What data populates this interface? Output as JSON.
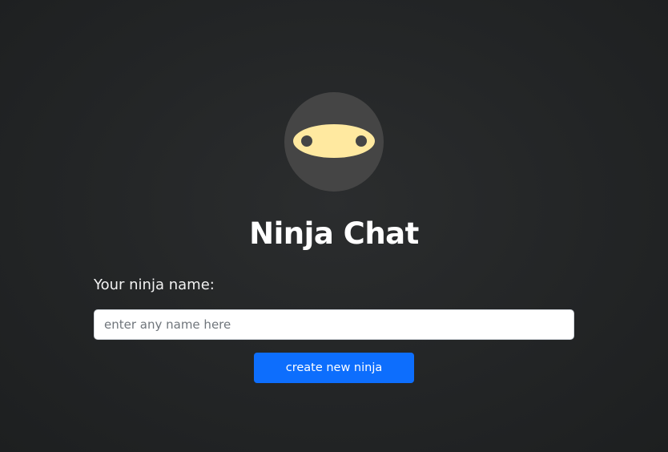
{
  "app": {
    "title": "Ninja Chat",
    "logo_icon": "ninja-face-icon"
  },
  "form": {
    "name_label": "Your ninja name:",
    "name_input": {
      "value": "",
      "placeholder": "enter any name here"
    },
    "submit_label": "create new ninja"
  },
  "colors": {
    "background": "#232526",
    "logo_circle": "#454545",
    "mask_band": "#ffe9a0",
    "eyes": "#454545",
    "button": "#0d6efd",
    "text": "#ffffff"
  }
}
